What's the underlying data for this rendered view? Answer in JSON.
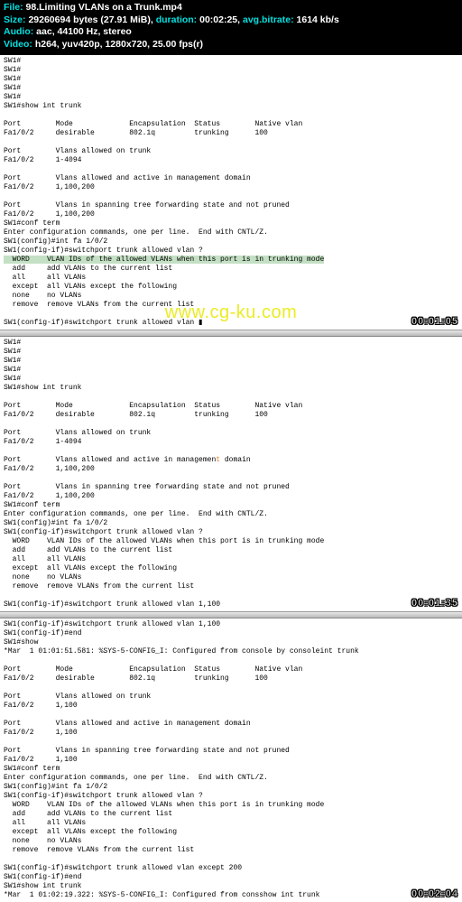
{
  "header": {
    "file_label": "File:",
    "file_value": "98.Limiting VLANs on a Trunk.mp4",
    "size_label": "Size:",
    "size_value": "29260694 bytes (27.91 MiB), ",
    "duration_label": "duration:",
    "duration_value": "00:02:25, ",
    "bitrate_label": "avg.bitrate:",
    "bitrate_value": "1614 kb/s",
    "audio_label": "Audio:",
    "audio_value": "aac, 44100 Hz, stereo",
    "video_label": "Video:",
    "video_value": "h264, yuv420p, 1280x720, 25.00 fps(r)"
  },
  "watermark": "www.cg-ku.com",
  "frame1": {
    "prompt_lines": "SW1#\nSW1#\nSW1#\nSW1#\nSW1#\nSW1#show int trunk\n",
    "table_hdr": "Port        Mode             Encapsulation  Status        Native vlan",
    "table_row": "Fa1/0/2     desirable        802.1q         trunking      100",
    "allowed_hdr": "Port        Vlans allowed on trunk",
    "allowed_row": "Fa1/0/2     1-4094",
    "active_hdr": "Port        Vlans allowed and active in management domain",
    "active_row": "Fa1/0/2     1,100,200",
    "stp_hdr": "Port        Vlans in spanning tree forwarding state and not pruned",
    "stp_row": "Fa1/0/2     1,100,200",
    "conf1": "SW1#conf term",
    "conf2": "Enter configuration commands, one per line.  End with CNTL/Z.",
    "conf3": "SW1(config)#int fa 1/0/2",
    "conf4": "SW1(config-if)#switchport trunk allowed vlan ?",
    "help1": "  WORD    VLAN IDs of the allowed VLANs when this port is in trunking mode",
    "help2": "  add     add VLANs to the current list",
    "help3": "  all     all VLANs",
    "help4": "  except  all VLANs except the following",
    "help5": "  none    no VLANs",
    "help6": "  remove  remove VLANs from the current list",
    "cmd": "SW1(config-if)#switchport trunk allowed vlan ▮",
    "ts": "00:01:05"
  },
  "frame2": {
    "prompt_lines": "SW1#\nSW1#\nSW1#\nSW1#\nSW1#\nSW1#show int trunk\n",
    "table_hdr": "Port        Mode             Encapsulation  Status        Native vlan",
    "table_row": "Fa1/0/2     desirable        802.1q         trunking      100",
    "allowed_hdr": "Port        Vlans allowed on trunk",
    "allowed_row": "Fa1/0/2     1-4094",
    "active_hdr_a": "Port        Vlans allowed and active in managemen",
    "active_hdr_b": "t",
    "active_hdr_c": " domain",
    "active_row": "Fa1/0/2     1,100,200",
    "stp_hdr": "Port        Vlans in spanning tree forwarding state and not pruned",
    "stp_row": "Fa1/0/2     1,100,200",
    "conf1": "SW1#conf term",
    "conf2": "Enter configuration commands, one per line.  End with CNTL/Z.",
    "conf3": "SW1(config)#int fa 1/0/2",
    "conf4": "SW1(config-if)#switchport trunk allowed vlan ?",
    "help1": "  WORD    VLAN IDs of the allowed VLANs when this port is in trunking mode",
    "help2": "  add     add VLANs to the current list",
    "help3": "  all     all VLANs",
    "help4": "  except  all VLANs except the following",
    "help5": "  none    no VLANs",
    "help6": "  remove  remove VLANs from the current list",
    "cmd": "SW1(config-if)#switchport trunk allowed vlan 1,100",
    "ts": "00:01:35"
  },
  "frame3": {
    "line1": "SW1(config-if)#switchport trunk allowed vlan 1,100",
    "line2": "SW1(config-if)#end",
    "line3": "SW1#show",
    "line4": "*Mar  1 01:01:51.581: %SYS-5-CONFIG_I: Configured from console by consoleint trunk",
    "table_hdr": "Port        Mode             Encapsulation  Status        Native vlan",
    "table_row": "Fa1/0/2     desirable        802.1q         trunking      100",
    "allowed_hdr": "Port        Vlans allowed on trunk",
    "allowed_row": "Fa1/0/2     1,100",
    "active_hdr": "Port        Vlans allowed and active in management domain",
    "active_row": "Fa1/0/2     1,100",
    "stp_hdr": "Port        Vlans in spanning tree forwarding state and not pruned",
    "stp_row": "Fa1/0/2     1,100",
    "conf1": "SW1#conf term",
    "conf2": "Enter configuration commands, one per line.  End with CNTL/Z.",
    "conf3": "SW1(config)#int fa 1/0/2",
    "conf4": "SW1(config-if)#switchport trunk allowed vlan ?",
    "help1": "  WORD    VLAN IDs of the allowed VLANs when this port is in trunking mode",
    "help2": "  add     add VLANs to the current list",
    "help3": "  all     all VLANs",
    "help4": "  except  all VLANs except the following",
    "help5": "  none    no VLANs",
    "help6": "  remove  remove VLANs from the current list",
    "cmd1": "SW1(config-if)#switchport trunk allowed vlan except 200",
    "cmd2": "SW1(config-if)#end",
    "cmd3": "SW1#show int trunk",
    "cmd4": "*Mar  1 01:02:19.322: %SYS-5-CONFIG_I: Configured from consshow int trunk",
    "ts": "00:02:04"
  }
}
